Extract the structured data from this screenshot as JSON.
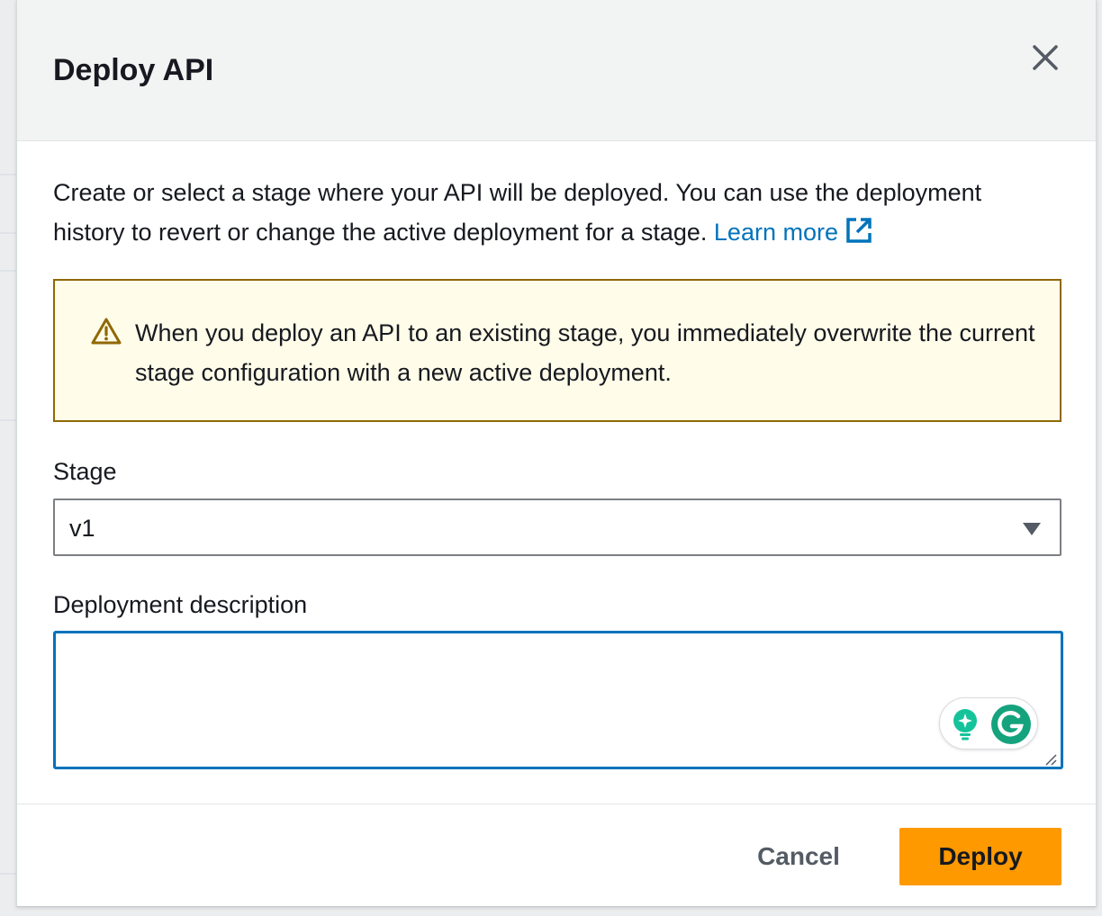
{
  "dialog": {
    "title": "Deploy API",
    "close_label": "Close",
    "intro_text": "Create or select a stage where your API will be deployed. You can use the deployment history to revert or change the active deployment for a stage. ",
    "learn_more_label": "Learn more"
  },
  "alert": {
    "type": "warning",
    "text": "When you deploy an API to an existing stage, you immediately overwrite the current stage configuration with a new active deployment."
  },
  "form": {
    "stage": {
      "label": "Stage",
      "value": "v1"
    },
    "description": {
      "label": "Deployment description",
      "value": ""
    }
  },
  "footer": {
    "cancel_label": "Cancel",
    "deploy_label": "Deploy"
  },
  "colors": {
    "primary_button": "#ff9900",
    "link": "#0073bb",
    "warning_border": "#906806",
    "warning_background": "#fffce9",
    "focus_border": "#0073bb",
    "header_background": "#f2f3f3",
    "grammarly_green": "#15c39a"
  },
  "icons": {
    "close": "close-icon",
    "external_link": "external-link-icon",
    "warning": "warning-icon",
    "dropdown": "caret-down-icon",
    "grammarly_suggestion": "lightbulb-icon",
    "grammarly": "grammarly-icon"
  }
}
